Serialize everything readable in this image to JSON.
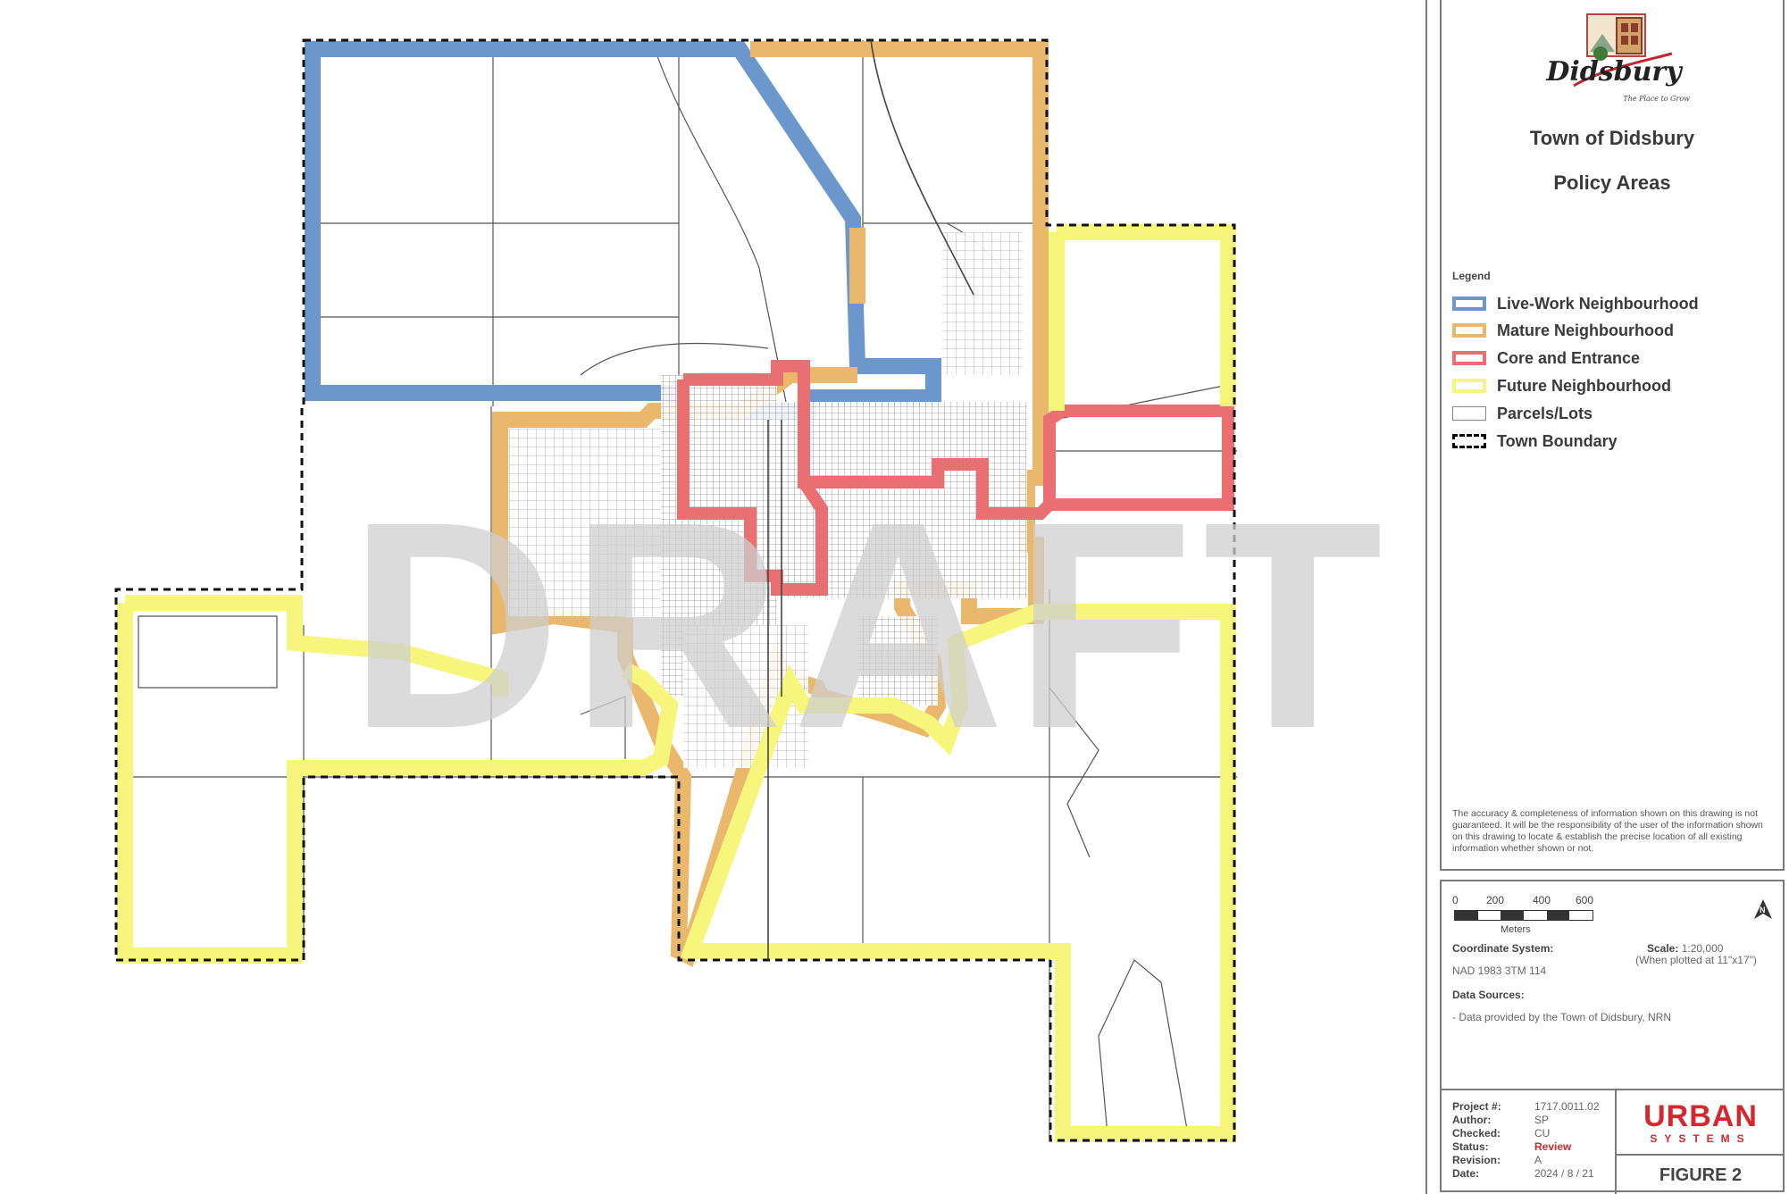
{
  "watermark": "DRAFT",
  "header": {
    "logo_text": "Didsbury",
    "logo_tagline": "The Place to Grow",
    "title": "Town of Didsbury",
    "subtitle": "Policy Areas"
  },
  "legend": {
    "heading": "Legend",
    "items": [
      {
        "label": "Live-Work Neighbourhood",
        "color": "#6b97cc"
      },
      {
        "label": "Mature Neighbourhood",
        "color": "#e9b86c"
      },
      {
        "label": "Core and Entrance",
        "color": "#ea6f73"
      },
      {
        "label": "Future Neighbourhood",
        "color": "#f6f57c"
      },
      {
        "label": "Parcels/Lots",
        "color": "#ffffff"
      },
      {
        "label": "Town Boundary",
        "color": "#000000"
      }
    ]
  },
  "disclaimer": "The accuracy & completeness of information shown on this drawing is not guaranteed.  It will be the responsibility of the user of the information shown on this drawing to locate & establish the precise location of all existing information whether shown or not.",
  "scale_bar": {
    "ticks": [
      "0",
      "200",
      "400",
      "600"
    ],
    "unit": "Meters",
    "scale_label": "Scale:",
    "scale_value": "1:20,000",
    "plot_note": "(When plotted at 11\"x17\")"
  },
  "north_arrow": "N",
  "coordinate_system": {
    "label": "Coordinate System:",
    "value": "NAD 1983 3TM 114"
  },
  "data_sources": {
    "label": "Data Sources:",
    "value": "- Data provided by the Town of Didsbury, NRN"
  },
  "project_info": {
    "project_label": "Project #:",
    "project_value": "1717.0011.02",
    "author_label": "Author:",
    "author_value": "SP",
    "checked_label": "Checked:",
    "checked_value": "CU",
    "status_label": "Status:",
    "status_value": "Review",
    "revision_label": "Revision:",
    "revision_value": "A",
    "date_label": "Date:",
    "date_value": "2024 / 8 / 21"
  },
  "brand": {
    "name": "URBAN",
    "sub": "SYSTEMS"
  },
  "figure": "FIGURE 2"
}
